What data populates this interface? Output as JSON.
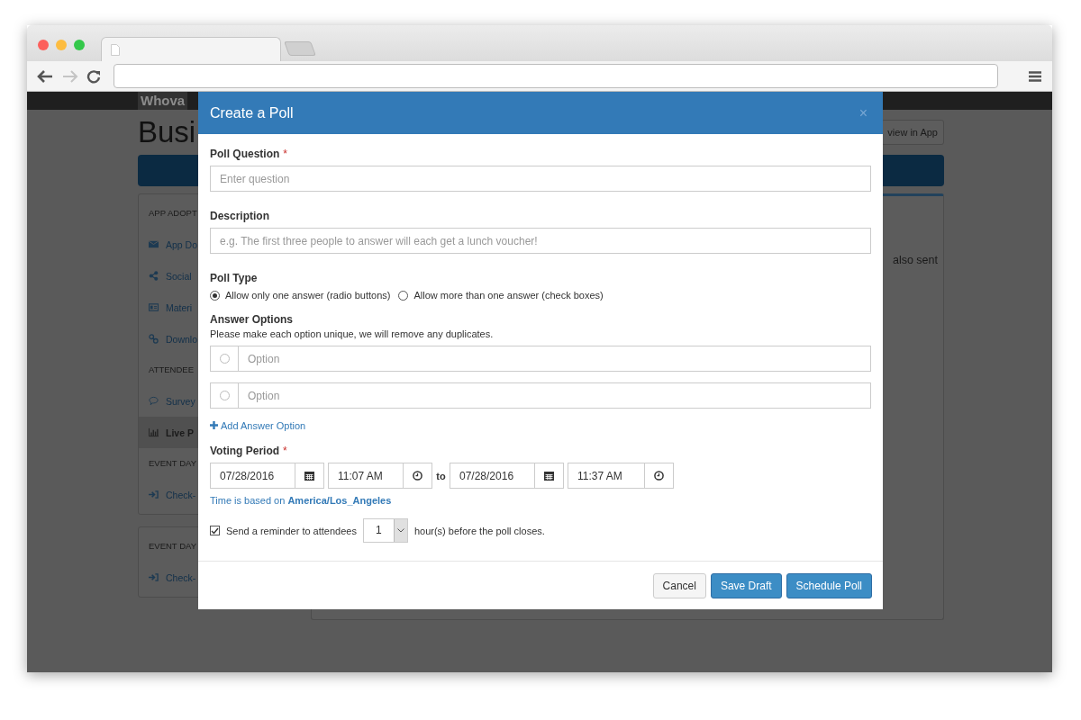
{
  "browser": {
    "forward_disabled": true
  },
  "background_page": {
    "brand": "Whova",
    "title": "Busi",
    "view_button": "view in App",
    "panel_text": "also sent",
    "sidebar_cards": [
      {
        "items": [
          {
            "kind": "heading",
            "label": "APP ADOPT"
          },
          {
            "kind": "item",
            "label": "App Do",
            "selected": false
          },
          {
            "kind": "item",
            "label": "Social",
            "selected": false
          },
          {
            "kind": "item",
            "label": "Materi",
            "selected": false
          },
          {
            "kind": "item",
            "label": "Downlo",
            "selected": false
          },
          {
            "kind": "heading",
            "label": "ATTENDEE"
          },
          {
            "kind": "item",
            "label": "Survey",
            "selected": false
          },
          {
            "kind": "item",
            "label": "Live P",
            "selected": true
          },
          {
            "kind": "heading",
            "label": "EVENT DAY"
          },
          {
            "kind": "item",
            "label": "Check-",
            "selected": false
          }
        ]
      },
      {
        "items": [
          {
            "kind": "heading",
            "label": "EVENT DAY"
          },
          {
            "kind": "item",
            "label": "Check-",
            "selected": false
          }
        ]
      }
    ]
  },
  "modal": {
    "title": "Create a Poll",
    "close": "×",
    "question": {
      "label": "Poll Question",
      "required_mark": "*",
      "placeholder": "Enter question"
    },
    "description": {
      "label": "Description",
      "placeholder": "e.g. The first three people to answer will each get a lunch voucher!"
    },
    "poll_type": {
      "label": "Poll Type",
      "options": [
        {
          "label": "Allow only one answer (radio buttons)",
          "selected": true
        },
        {
          "label": "Allow more than one answer (check boxes)",
          "selected": false
        }
      ]
    },
    "answer_options": {
      "label": "Answer Options",
      "hint": "Please make each option unique, we will remove any duplicates.",
      "rows": [
        {
          "placeholder": "Option"
        },
        {
          "placeholder": "Option"
        }
      ],
      "add_link": "Add Answer Option"
    },
    "voting_period": {
      "label": "Voting Period",
      "required_mark": "*",
      "start_date": "07/28/2016",
      "start_time": "11:07 AM",
      "separator": "to",
      "end_date": "07/28/2016",
      "end_time": "11:37 AM",
      "timezone_note": "Time is based on **America/Los_Angeles**"
    },
    "reminder": {
      "checked": true,
      "label": "Send a reminder to attendees",
      "hours": "1",
      "suffix": "hour(s) before the poll closes."
    },
    "buttons": [
      {
        "kind": "default",
        "label": "Cancel"
      },
      {
        "kind": "primary",
        "label": "Save Draft"
      },
      {
        "kind": "primary",
        "label": "Schedule Poll"
      }
    ]
  }
}
